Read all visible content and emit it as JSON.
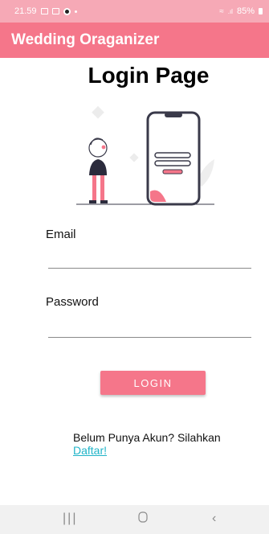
{
  "status_bar": {
    "time": "21.59",
    "battery": "85%"
  },
  "app_bar": {
    "title": "Wedding Oraganizer"
  },
  "page": {
    "title": "Login Page"
  },
  "form": {
    "email_label": "Email",
    "email_value": "",
    "password_label": "Password",
    "password_value": "",
    "login_button": "LOGIN"
  },
  "register": {
    "prompt": "Belum Punya Akun? Silahkan",
    "link": "Daftar!"
  },
  "colors": {
    "primary": "#f5768a",
    "status_bar": "#f6a9b6",
    "link": "#20b4c8"
  },
  "icons": {
    "nav_recents": "recent-apps-icon",
    "nav_home": "home-icon",
    "nav_back": "back-icon"
  }
}
